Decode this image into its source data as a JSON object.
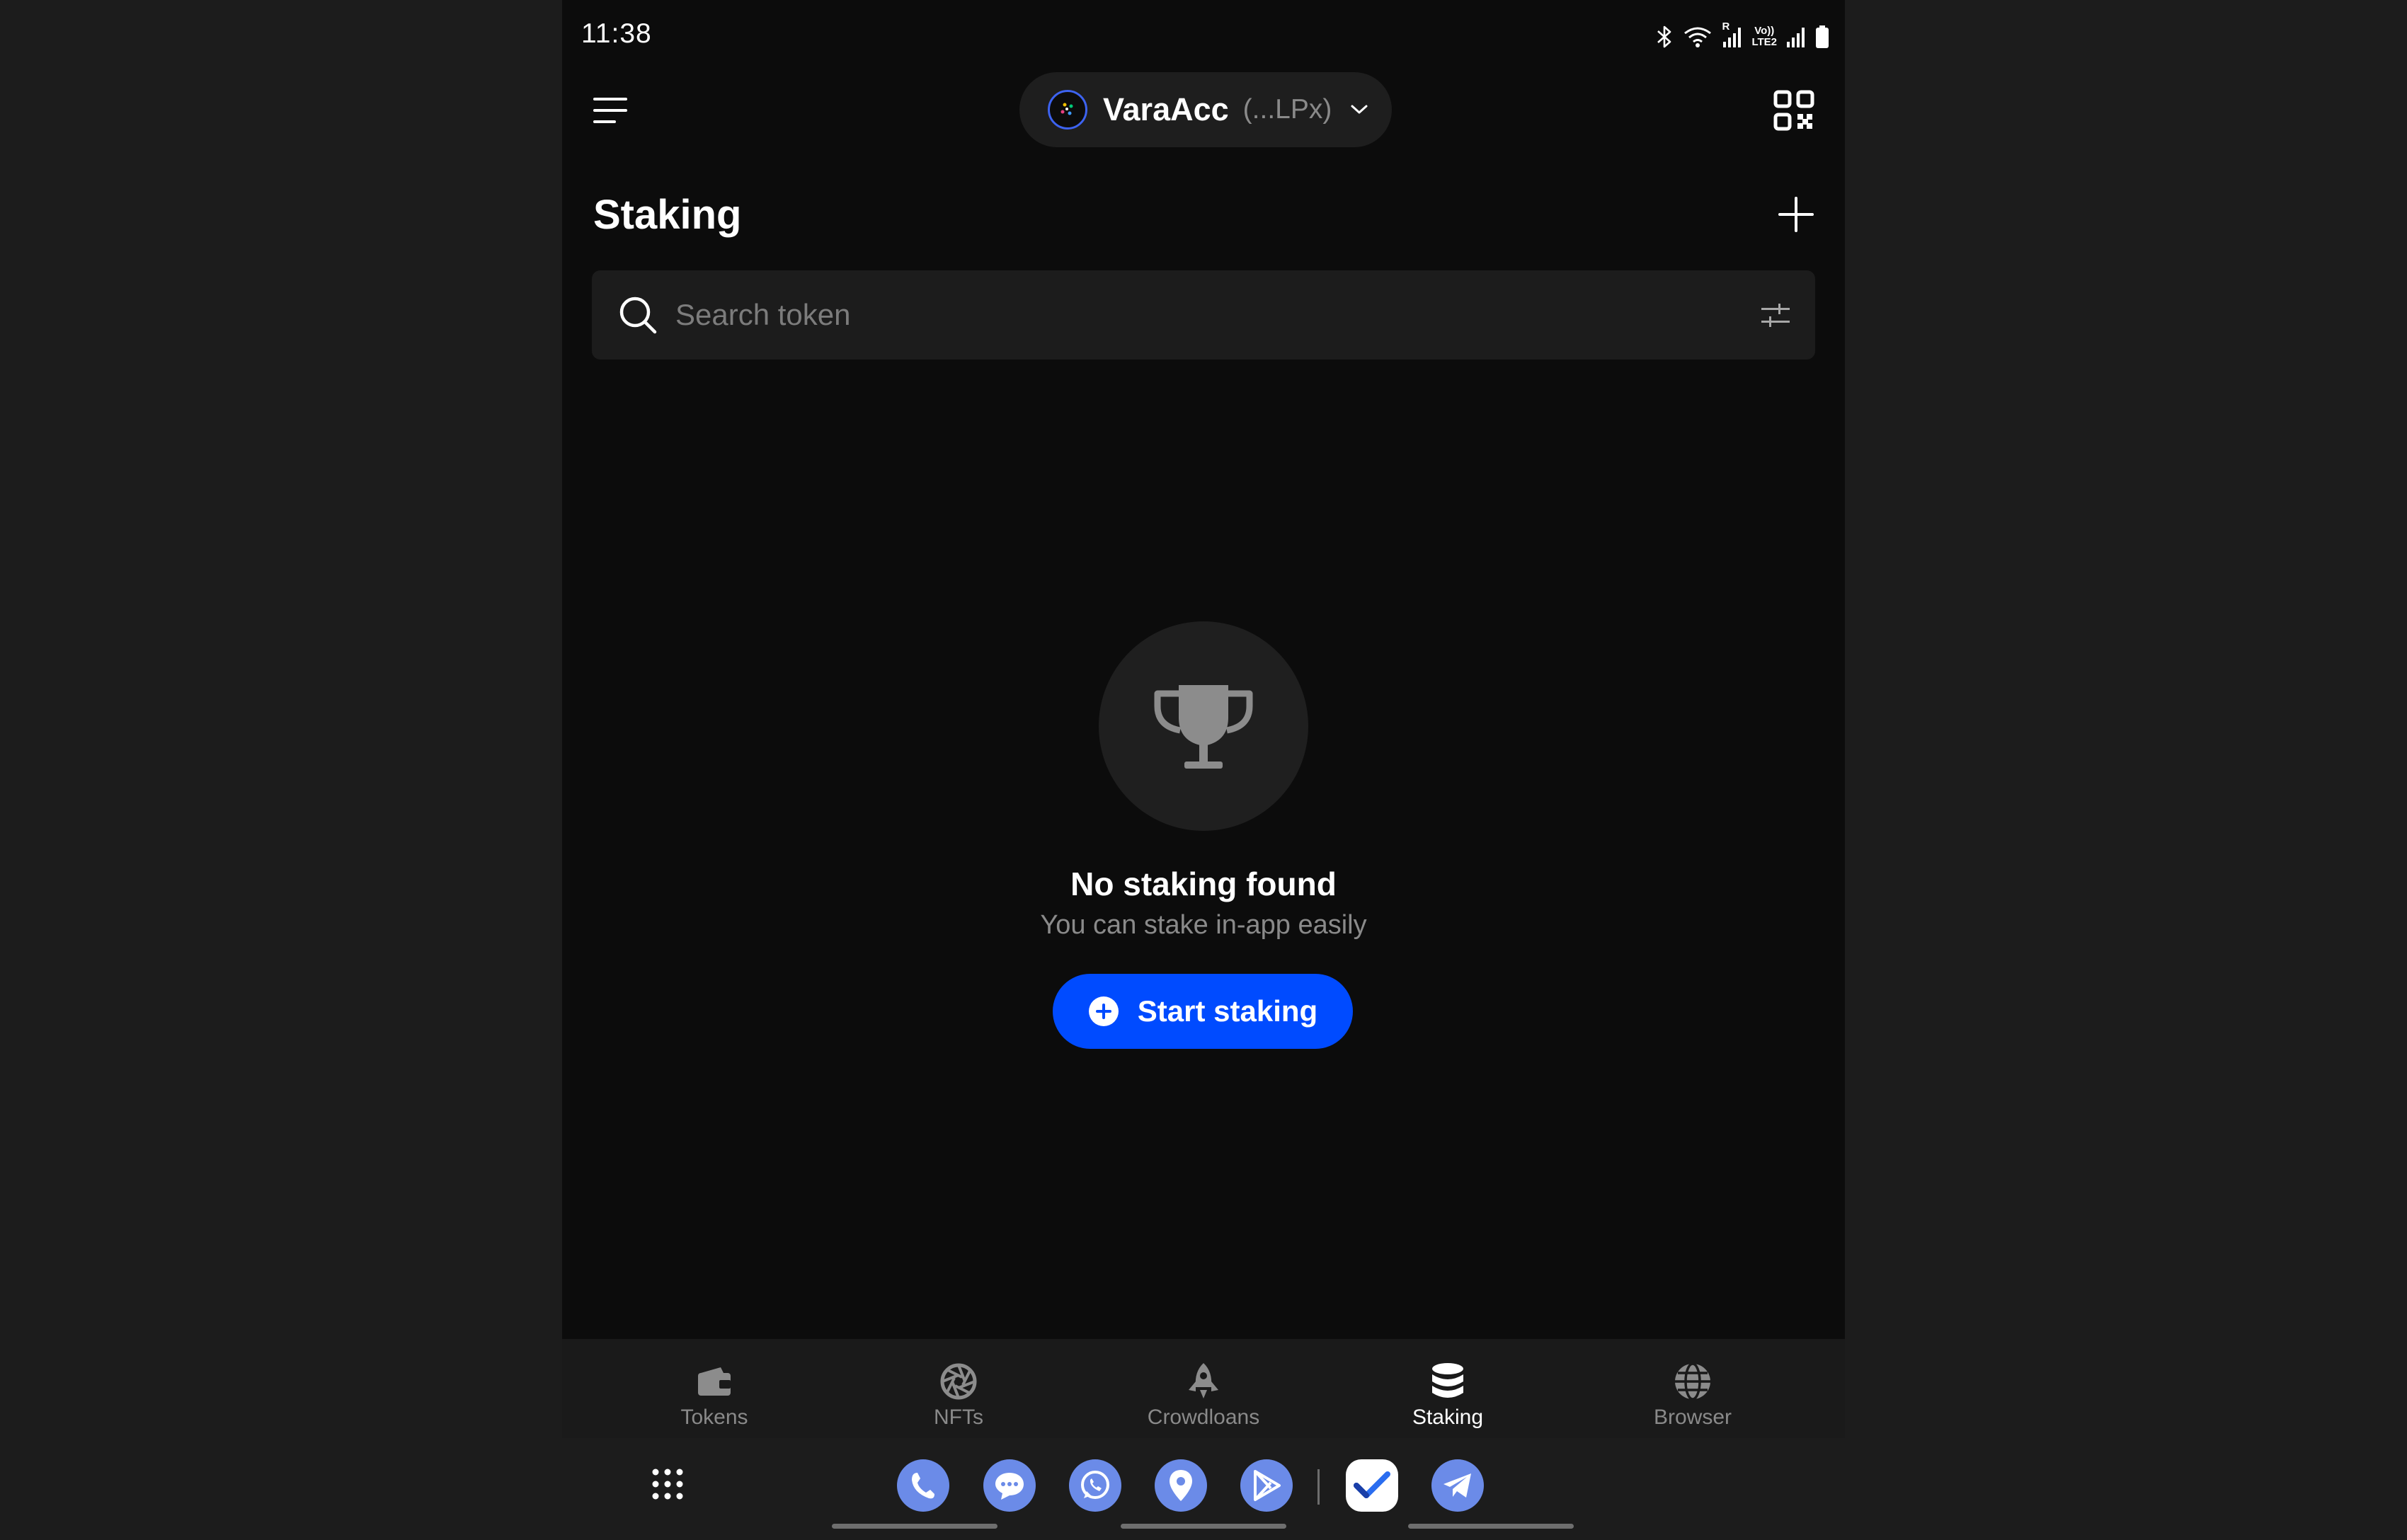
{
  "status_bar": {
    "time": "11:38",
    "volte_line1": "Vo))",
    "volte_line2": "LTE2",
    "roaming": "R"
  },
  "header": {
    "account_name": "VaraAcc",
    "account_address": "(...LPx)"
  },
  "page": {
    "title": "Staking"
  },
  "search": {
    "placeholder": "Search token",
    "value": ""
  },
  "empty_state": {
    "title": "No staking found",
    "subtitle": "You can stake in-app easily",
    "button_label": "Start staking"
  },
  "bottom_nav": {
    "items": [
      {
        "label": "Tokens",
        "icon": "wallet-icon",
        "active": false
      },
      {
        "label": "NFTs",
        "icon": "aperture-icon",
        "active": false
      },
      {
        "label": "Crowdloans",
        "icon": "rocket-icon",
        "active": false
      },
      {
        "label": "Staking",
        "icon": "database-icon",
        "active": true
      },
      {
        "label": "Browser",
        "icon": "globe-icon",
        "active": false
      }
    ]
  },
  "taskbar": {
    "apps": [
      "phone-app",
      "messages-app",
      "whatsapp-app",
      "maps-app",
      "play-store-app",
      "tasks-app",
      "telegram-app"
    ]
  },
  "colors": {
    "accent": "#004bff",
    "background": "#0c0c0c",
    "surface": "#1c1c1c",
    "muted_text": "#8a8a8a",
    "dock_icon": "#6b8be8"
  }
}
